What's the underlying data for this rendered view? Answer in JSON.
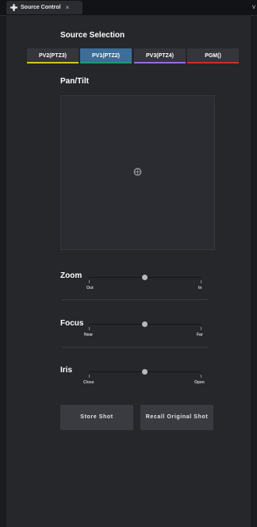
{
  "tab": {
    "title": "Source Control",
    "close": "×",
    "dropdown": "v",
    "icon": "plus-gear-icon"
  },
  "source_selection": {
    "title": "Source Selection",
    "buttons": [
      {
        "label": "PV2(PTZ3)",
        "color": "#d4c31f",
        "active": false
      },
      {
        "label": "PV1(PTZ2)",
        "color": "#1f9a6a",
        "active": true
      },
      {
        "label": "PV3(PTZ4)",
        "color": "#9e6bd6",
        "active": false
      },
      {
        "label": "PGM()",
        "color": "#c9302c",
        "active": false
      }
    ]
  },
  "pan_tilt": {
    "title": "Pan/Tilt"
  },
  "sliders": {
    "zoom": {
      "label": "Zoom",
      "min_label": "Out",
      "max_label": "In",
      "value": 0.5
    },
    "focus": {
      "label": "Focus",
      "min_label": "Near",
      "max_label": "Far",
      "value": 0.5
    },
    "iris": {
      "label": "Iris",
      "min_label": "Close",
      "max_label": "Open",
      "value": 0.5
    }
  },
  "actions": {
    "store": "Store Shot",
    "recall": "Recall Original Shot"
  },
  "colors": {
    "active_source": "#3b6e99",
    "panel": "#26272b"
  }
}
